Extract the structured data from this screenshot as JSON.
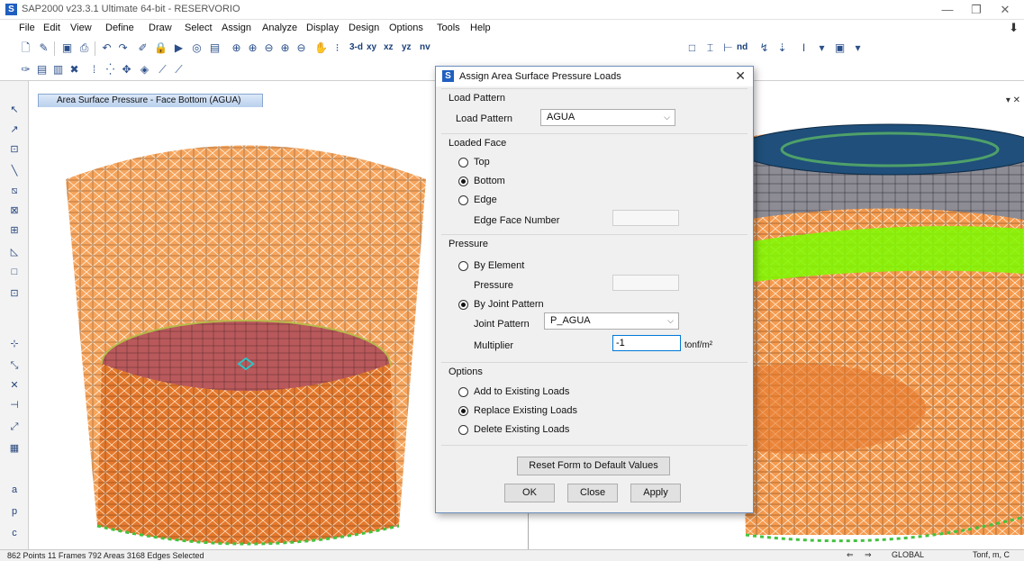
{
  "window": {
    "title": "SAP2000 v23.3.1 Ultimate 64-bit - RESERVORIO",
    "app_icon": "S"
  },
  "menu": [
    "File",
    "Edit",
    "View",
    "Define",
    "Draw",
    "Select",
    "Assign",
    "Analyze",
    "Display",
    "Design",
    "Options",
    "Tools",
    "Help"
  ],
  "toolbar": {
    "view_labels": [
      "3-d",
      "xy",
      "xz",
      "yz",
      "nv"
    ]
  },
  "left_view": {
    "tab_title": "Area Surface Pressure - Face Bottom (AGUA)"
  },
  "dialog": {
    "title": "Assign Area Surface Pressure Loads",
    "load_pattern_group": "Load Pattern",
    "load_pattern_label": "Load Pattern",
    "load_pattern_value": "AGUA",
    "loaded_face_group": "Loaded Face",
    "face_top": "Top",
    "face_bottom": "Bottom",
    "face_edge": "Edge",
    "edge_face_number_label": "Edge Face Number",
    "pressure_group": "Pressure",
    "by_element": "By Element",
    "pressure_label": "Pressure",
    "by_joint_pattern": "By Joint Pattern",
    "joint_pattern_label": "Joint Pattern",
    "joint_pattern_value": "P_AGUA",
    "multiplier_label": "Multiplier",
    "multiplier_value": "-1",
    "multiplier_unit": "tonf/m²",
    "options_group": "Options",
    "opt_add": "Add to Existing Loads",
    "opt_replace": "Replace Existing Loads",
    "opt_delete": "Delete Existing Loads",
    "reset_button": "Reset Form to Default Values",
    "ok_button": "OK",
    "close_button": "Close",
    "apply_button": "Apply"
  },
  "status": {
    "text": "862 Points  11 Frames  792 Areas  3168 Edges Selected",
    "coord_system": "GLOBAL",
    "units": "Tonf, m, C"
  },
  "colors": {
    "shell_orange": "#f4a460",
    "bottom_red": "#b85a5a",
    "dome_blue": "#1f4f7a",
    "band_green": "#7cfc00",
    "accent": "#0078d7"
  }
}
